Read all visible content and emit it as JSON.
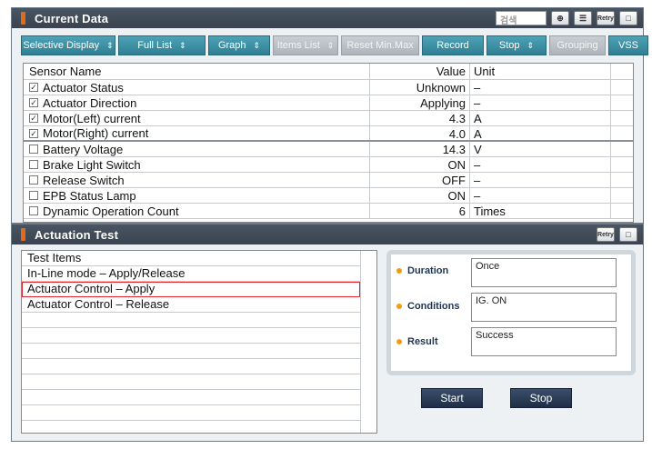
{
  "current_data": {
    "title": "Current Data",
    "search_placeholder": "검색",
    "toolbar": [
      {
        "label": "Selective Display",
        "arrow": "⇕",
        "disabled": false
      },
      {
        "label": "Full List",
        "arrow": "⇕",
        "disabled": false
      },
      {
        "label": "Graph",
        "arrow": "⇕",
        "disabled": false
      },
      {
        "label": "Items List",
        "arrow": "⇕",
        "disabled": true
      },
      {
        "label": "Reset Min.Max",
        "arrow": "",
        "disabled": true
      },
      {
        "label": "Record",
        "arrow": "",
        "disabled": false
      },
      {
        "label": "Stop",
        "arrow": "⇕",
        "disabled": false
      },
      {
        "label": "Grouping",
        "arrow": "",
        "disabled": true
      },
      {
        "label": "VSS",
        "arrow": "",
        "disabled": false
      }
    ],
    "columns": {
      "name": "Sensor Name",
      "value": "Value",
      "unit": "Unit"
    },
    "rows": [
      {
        "name": "Actuator Status",
        "value": "Unknown",
        "unit": "–",
        "checked": true
      },
      {
        "name": "Actuator Direction",
        "value": "Applying",
        "unit": "–",
        "checked": true
      },
      {
        "name": "Motor(Left) current",
        "value": "4.3",
        "unit": "A",
        "checked": true
      },
      {
        "name": "Motor(Right) current",
        "value": "4.0",
        "unit": "A",
        "checked": true
      },
      {
        "name": "Battery Voltage",
        "value": "14.3",
        "unit": "V",
        "checked": false
      },
      {
        "name": "Brake Light Switch",
        "value": "ON",
        "unit": "–",
        "checked": false
      },
      {
        "name": "Release Switch",
        "value": "OFF",
        "unit": "–",
        "checked": false
      },
      {
        "name": "EPB Status Lamp",
        "value": "ON",
        "unit": "–",
        "checked": false
      },
      {
        "name": "Dynamic Operation Count",
        "value": "6",
        "unit": "Times",
        "checked": false
      }
    ]
  },
  "actuation_test": {
    "title": "Actuation Test",
    "list_header": "Test Items",
    "items": [
      "In-Line mode – Apply/Release",
      "Actuator Control – Apply",
      "Actuator Control – Release"
    ],
    "selected_index": 1,
    "info": {
      "duration_label": "Duration",
      "duration_value": "Once",
      "conditions_label": "Conditions",
      "conditions_value": "IG. ON",
      "result_label": "Result",
      "result_value": "Success"
    },
    "start_label": "Start",
    "stop_label": "Stop"
  },
  "icons": {
    "retry": "Retry",
    "zoom": "⊕",
    "list": "☰",
    "window": "□"
  },
  "colors": {
    "accent": "#3a8fa3",
    "title_bar": "#3f4956",
    "marker": "#e46a1a",
    "selected_outline": "#e0262e",
    "button_dark": "#2a3a55"
  }
}
